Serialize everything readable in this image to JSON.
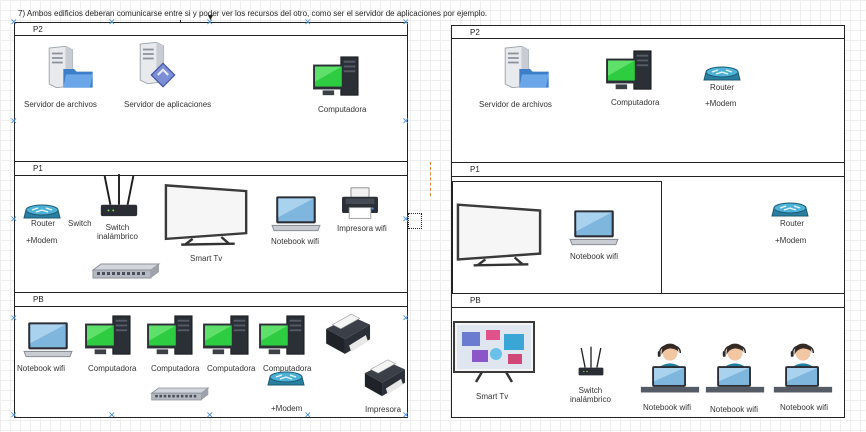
{
  "title": "7) Ambos edificios deberan comunicarse entre si y poder ver los recursos del otro, como ser el servidor de aplicaciones por ejemplo.",
  "left": {
    "floors": {
      "p2": "P2",
      "p1": "P1",
      "pb": "PB"
    },
    "p2": {
      "file_server": "Servidor de archivos",
      "app_server": "Servidor de aplicaciones",
      "computer": "Computadora"
    },
    "p1": {
      "router": "Router",
      "modem": "+Modem",
      "switch": "Switch",
      "wireless_switch_1": "Switch",
      "wireless_switch_2": "inalámbrico",
      "smart_tv": "Smart Tv",
      "notebook": "Notebook wifi",
      "printer": "Impresora wifi"
    },
    "pb": {
      "notebook": "Notebook wifi",
      "computers": [
        "Computadora",
        "Computadora",
        "Computadora",
        "Computadora"
      ],
      "modem": "+Modem",
      "printer": "Impresora"
    }
  },
  "right": {
    "floors": {
      "p2": "P2",
      "p1": "P1",
      "pb": "PB"
    },
    "p2": {
      "file_server": "Servidor de archivos",
      "computer": "Computadora",
      "router": "Router",
      "modem": "+Modem"
    },
    "p1": {
      "notebook": "Notebook wifi",
      "router": "Router",
      "modem": "+Modem"
    },
    "pb": {
      "smart_tv": "Smart Tv",
      "wireless_switch_1": "Switch",
      "wireless_switch_2": "inalámbrico",
      "notebooks": [
        "Notebook wifi",
        "Notebook wifi",
        "Notebook wifi"
      ]
    }
  }
}
